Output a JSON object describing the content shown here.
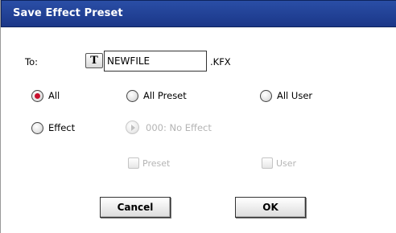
{
  "dialog": {
    "title": "Save Effect Preset"
  },
  "destination": {
    "to_label": "To:",
    "text_edit_button": "T",
    "filename_value": "NEWFILE",
    "extension": ".KFX"
  },
  "options": {
    "all": "All",
    "all_preset": "All Preset",
    "all_user": "All User",
    "effect": "Effect",
    "selected": "All"
  },
  "effect_select": {
    "value": "000: No Effect",
    "icon": "arrow-right-icon"
  },
  "filters": {
    "preset": "Preset",
    "user": "User"
  },
  "buttons": {
    "cancel": "Cancel",
    "ok": "OK"
  },
  "colors": {
    "title_bar": "#1f3f94",
    "radio_selected": "#c8102e",
    "disabled_text": "#b4b4b4"
  }
}
